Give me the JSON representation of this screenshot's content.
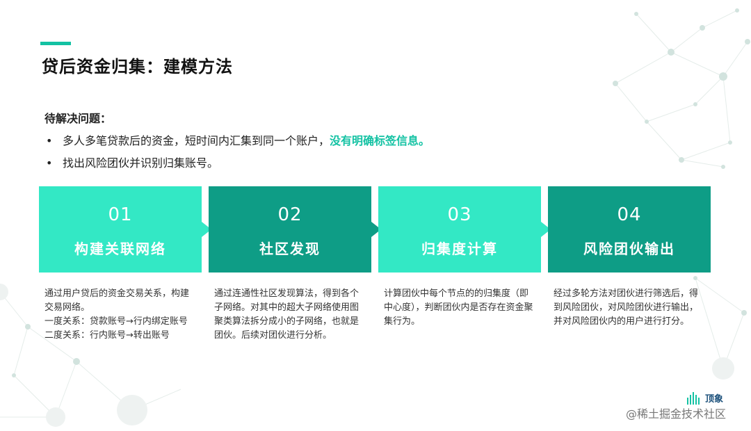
{
  "slide": {
    "title": "贷后资金归集：建模方法",
    "problem_heading": "待解决问题：",
    "bullets": [
      {
        "text": "多人多笔贷款后的资金，短时间内汇集到同一个账户，",
        "highlight": "没有明确标签信息。"
      },
      {
        "text": "找出风险团伙并识别归集账号。",
        "highlight": ""
      }
    ],
    "bullet_symbol": "•"
  },
  "steps": [
    {
      "number": "01",
      "name": "构建关联网络",
      "description": [
        "通过用户贷后的资金交易关系，构建交易网络。",
        "一度关系：贷款账号→行内绑定账号",
        "二度关系：行内账号→转出账号"
      ]
    },
    {
      "number": "02",
      "name": "社区发现",
      "description": [
        "通过连通性社区发现算法，得到各个子网络。对其中的超大子网络使用图聚类算法拆分成小的子网络，也就是团伙。后续对团伙进行分析。"
      ]
    },
    {
      "number": "03",
      "name": "归集度计算",
      "description": [
        "计算团伙中每个节点的的归集度（即中心度），判断团伙内是否存在资金聚集行为。"
      ]
    },
    {
      "number": "04",
      "name": "风险团伙输出",
      "description": [
        "经过多轮方法对团伙进行筛选后，得到风险团伙，对风险团伙进行输出，并对风险团伙内的用户进行打分。"
      ]
    }
  ],
  "footer": {
    "logo_text": "顶象",
    "watermark": "@稀土掘金技术社区"
  },
  "colors": {
    "accent": "#13c2a3",
    "step_light": "#33e8c5",
    "step_dark": "#0e9d86"
  }
}
